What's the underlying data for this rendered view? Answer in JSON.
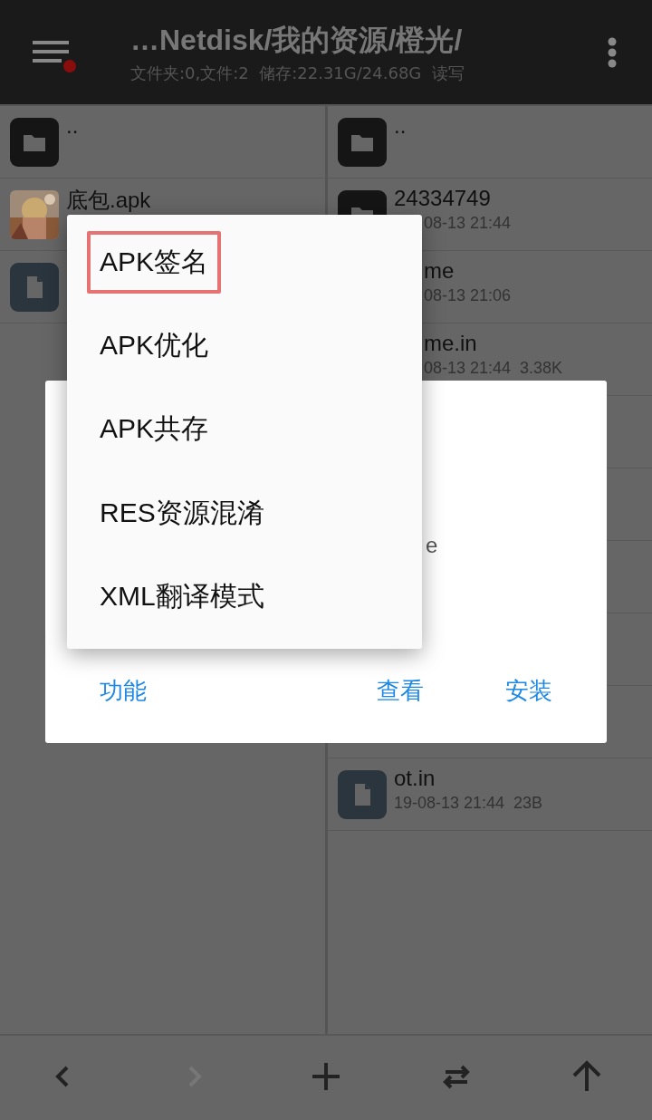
{
  "header": {
    "path": "…Netdisk/我的资源/橙光/",
    "info": "文件夹:0,文件:2  储存:22.31G/24.68G  读写",
    "notification": true
  },
  "left_pane": {
    "rows": [
      {
        "kind": "folder",
        "name": ".."
      },
      {
        "kind": "picture",
        "name": "底包.apk"
      },
      {
        "kind": "file"
      }
    ]
  },
  "right_pane": {
    "rows": [
      {
        "kind": "folder",
        "name": ".."
      },
      {
        "kind": "folder",
        "name": "24334749",
        "meta": "08-13 21:44"
      },
      {
        "kind": "none",
        "name": "me",
        "meta": "08-13 21:06"
      },
      {
        "kind": "none",
        "name": "me.in",
        "meta": "08-13 21:44  3.38K"
      },
      {
        "kind": "blank"
      },
      {
        "kind": "blank"
      },
      {
        "kind": "blank"
      },
      {
        "kind": "blank"
      },
      {
        "kind": "blank"
      },
      {
        "kind": "file",
        "name": "ot.in",
        "meta": "19-08-13 21:44  23B"
      }
    ]
  },
  "dialog": {
    "text": "e",
    "buttons": [
      {
        "label": "功能"
      },
      {
        "label": "查看"
      },
      {
        "label": "安装"
      }
    ]
  },
  "menu": {
    "items": [
      {
        "label": "APK签名",
        "highlighted": true
      },
      {
        "label": "APK优化",
        "highlighted": false
      },
      {
        "label": "APK共存",
        "highlighted": false
      },
      {
        "label": "RES资源混淆",
        "highlighted": false
      },
      {
        "label": "XML翻译模式",
        "highlighted": false
      }
    ]
  },
  "bottom_bar": {
    "buttons": [
      {
        "kind": "back",
        "disabled": false
      },
      {
        "kind": "forward",
        "disabled": true
      },
      {
        "kind": "add",
        "disabled": false
      },
      {
        "kind": "swap",
        "disabled": false
      },
      {
        "kind": "up",
        "disabled": false
      }
    ]
  }
}
